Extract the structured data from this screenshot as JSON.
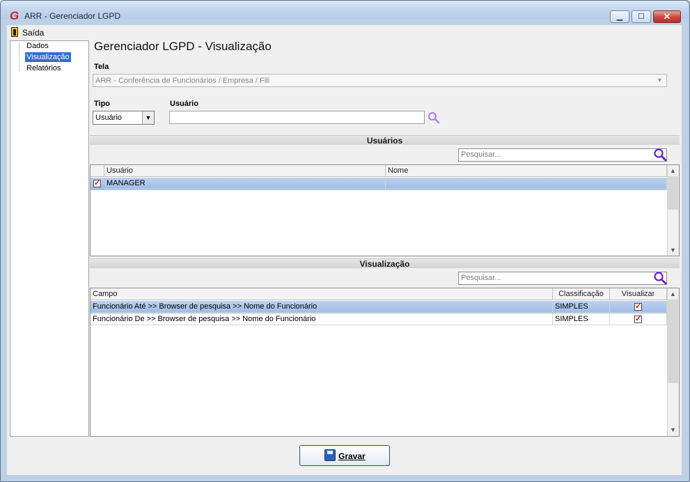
{
  "window": {
    "title": "ARR - Gerenciador LGPD",
    "app_icon_letter": "G",
    "minimize_glyph": "▁",
    "maximize_glyph": "☐",
    "close_glyph": "✕"
  },
  "menu": {
    "exit_label": "Saída"
  },
  "tree": {
    "items": [
      {
        "label": "Dados",
        "selected": false
      },
      {
        "label": "Visualização",
        "selected": true
      },
      {
        "label": "Relatórios",
        "selected": false
      }
    ]
  },
  "main": {
    "title": "Gerenciador LGPD - Visualização",
    "tela": {
      "label": "Tela",
      "value": "ARR - Conferência de Funcionários / Empresa / Fili"
    },
    "tipo": {
      "label": "Tipo",
      "value": "Usuário"
    },
    "usuario": {
      "label": "Usuário",
      "value": ""
    }
  },
  "usuarios_section": {
    "header": "Usuários",
    "search_placeholder": "Pesquisar...",
    "columns": [
      "Usuário",
      "Nome"
    ],
    "rows": [
      {
        "checked": true,
        "usuario": "MANAGER",
        "nome": ""
      }
    ]
  },
  "visualizacao_section": {
    "header": "Visualização",
    "search_placeholder": "Pesquisar...",
    "columns": [
      "Campo",
      "Classificação",
      "Visualizar"
    ],
    "rows": [
      {
        "campo": "Funcionário Até >> Browser de pesquisa >> Nome do Funcionário",
        "classificacao": "SIMPLES",
        "visualizar": true
      },
      {
        "campo": "Funcionário De >> Browser de pesquisa >> Nome do Funcionário",
        "classificacao": "SIMPLES",
        "visualizar": true
      }
    ]
  },
  "footer": {
    "save_label": "Gravar"
  },
  "colors": {
    "selection": "#9dbbe6",
    "tree_selection": "#2f6fcb",
    "search_icon": "#6a1fd0",
    "check_mark": "#d4151f",
    "app_icon": "#cc1e2a"
  }
}
